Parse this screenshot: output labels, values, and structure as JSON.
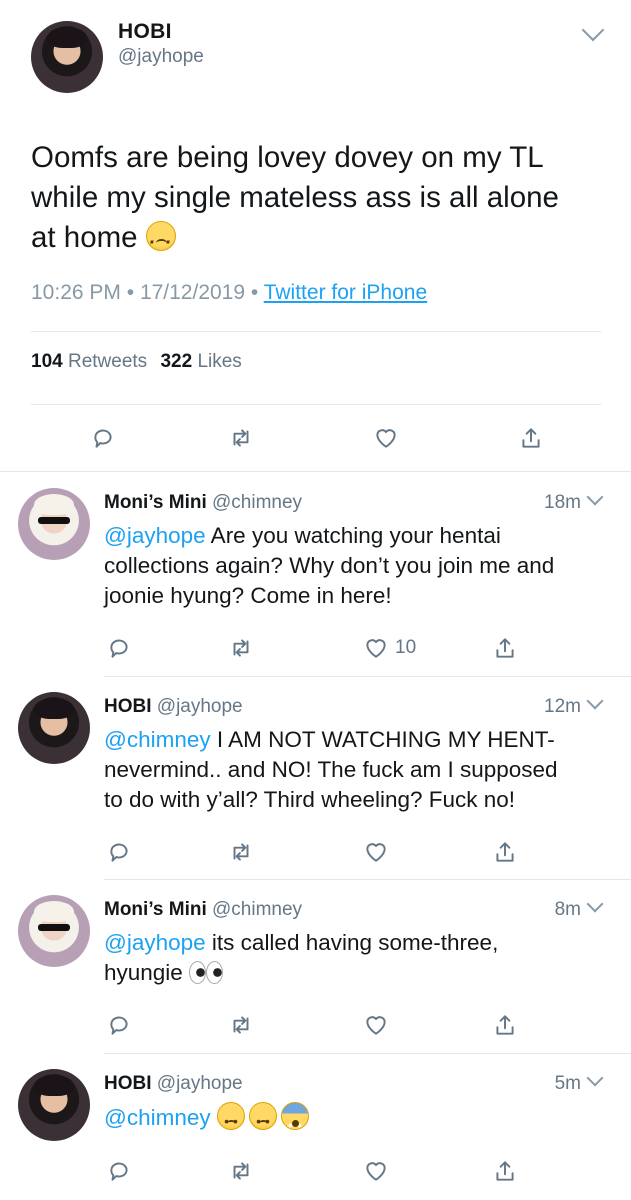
{
  "main_tweet": {
    "name": "HOBI",
    "handle": "@jayhope",
    "text_lines": [
      "Oomfs are being lovey dovey on my TL",
      "while my single mateless ass is all alone",
      "at home "
    ],
    "emoji": "frowning-face",
    "time": "10:26 PM",
    "separator": "•",
    "date": "17/12/2019",
    "source": "Twitter for iPhone",
    "retweets_count": "104",
    "retweets_label": "Retweets",
    "likes_count": "322",
    "likes_label": "Likes"
  },
  "replies": [
    {
      "name": "Moni’s Mini",
      "handle": "@chimney",
      "time": "18m",
      "mention": "@jayhope",
      "text_first": " Are you watching your hentai",
      "text_rest": [
        "collections again? Why don’t you join me and",
        "joonie hyung? Come in here!"
      ],
      "like_count": "10"
    },
    {
      "name": "HOBI",
      "handle": "@jayhope",
      "time": "12m",
      "mention": "@chimney",
      "text_first": " I AM NOT WATCHING MY HENT-",
      "text_rest": [
        "nevermind.. and NO! The fuck am I supposed",
        "to do with y’all? Third wheeling? Fuck no!"
      ],
      "like_count": ""
    },
    {
      "name": "Moni’s Mini",
      "handle": "@chimney",
      "time": "8m",
      "mention": "@jayhope",
      "text_first": " its called having some-three,",
      "text_rest": [
        "hyungie "
      ],
      "emoji": "eyes",
      "like_count": ""
    },
    {
      "name": "HOBI",
      "handle": "@jayhope",
      "time": "5m",
      "mention": "@chimney",
      "text_first": " ",
      "emojis": [
        "worried-face",
        "hushed-face",
        "fearful-face"
      ],
      "like_count": ""
    }
  ],
  "icons": {
    "reply": "reply-icon",
    "retweet": "retweet-icon",
    "like": "heart-icon",
    "share": "share-icon",
    "more": "chevron-down-icon"
  },
  "colors": {
    "link": "#1da1f2",
    "muted": "#657786",
    "divider": "#e1e8ed",
    "text": "#14171a"
  }
}
